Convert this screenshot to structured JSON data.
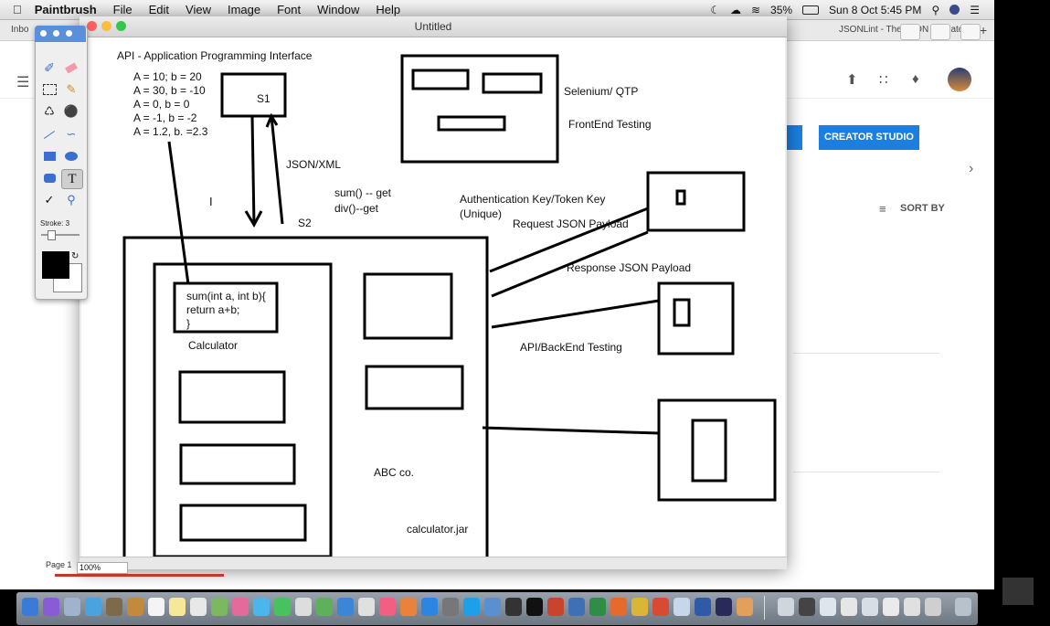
{
  "menubar": {
    "app_name": "Paintbrush",
    "items": [
      "File",
      "Edit",
      "View",
      "Image",
      "Font",
      "Window",
      "Help"
    ],
    "battery": "35%",
    "datetime": "Sun 8 Oct  5:45 PM"
  },
  "browser": {
    "tab_left": "Inbo",
    "tab_right": "JSONLint - The JSON Validator",
    "creator_studio": "CREATOR STUDIO",
    "sort_by": "SORT BY"
  },
  "window": {
    "title": "Untitled",
    "page_label": "Page 1",
    "zoom": "100%"
  },
  "palette": {
    "stroke_label": "Stroke: 3",
    "foreground_color": "#000000",
    "background_color": "#ffffff"
  },
  "drawing": {
    "heading": "API - Application Programming Interface",
    "equations": [
      "A = 10; b = 20",
      "A = 30, b = -10",
      "A = 0, b = 0",
      "A = -1, b = -2",
      "A = 1.2, b. =2.3"
    ],
    "s1": "S1",
    "s2": "S2",
    "json_xml": "JSON/XML",
    "sum_get": "sum() -- get",
    "div_get": "div()--get",
    "selenium": "Selenium/ QTP",
    "frontend": "FrontEnd Testing",
    "auth_key": "Authentication Key/Token Key",
    "unique": "(Unique)",
    "request_payload": "Request JSON Payload",
    "response_payload": "Response JSON Payload",
    "backend": "API/BackEnd Testing",
    "code_line1": "sum(int a, int b){",
    "code_line2": "return a+b;",
    "code_line3": "}",
    "calculator": "Calculator",
    "abc": "ABC co.",
    "jar": "calculator.jar"
  },
  "colors": {
    "accent_blue": "#1c7fe0",
    "palette_header": "#5b8fd9",
    "close_red": "#fc605c",
    "minimize_yellow": "#fdbc40",
    "zoom_green": "#34c84a"
  }
}
